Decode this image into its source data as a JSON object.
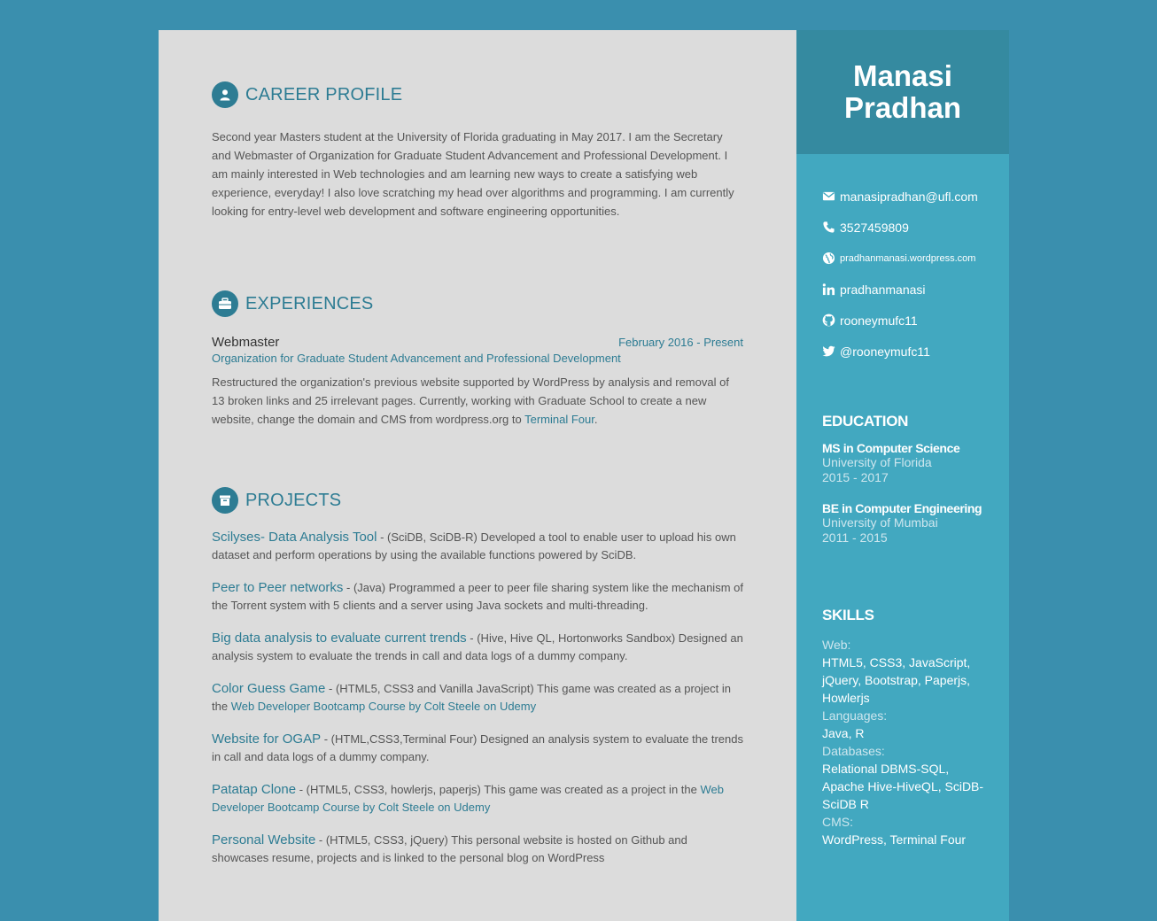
{
  "profile": {
    "first_name": "Manasi",
    "last_name": "Pradhan"
  },
  "contact": [
    {
      "icon": "envelope-icon",
      "text": "manasipradhan@ufl.com"
    },
    {
      "icon": "phone-icon",
      "text": "3527459809"
    },
    {
      "icon": "globe-icon",
      "text": "pradhanmanasi.wordpress.com"
    },
    {
      "icon": "linkedin-icon",
      "text": "pradhanmanasi"
    },
    {
      "icon": "github-icon",
      "text": "rooneymufc11"
    },
    {
      "icon": "twitter-icon",
      "text": "@rooneymufc11"
    }
  ],
  "education": {
    "title": "EDUCATION",
    "items": [
      {
        "degree": "MS in Computer Science",
        "school": "University of Florida",
        "years": "2015 - 2017"
      },
      {
        "degree": "BE in Computer Engineering",
        "school": "University of Mumbai",
        "years": "2011 - 2015"
      }
    ]
  },
  "skills": {
    "title": "SKILLS",
    "groups": [
      {
        "category": "Web:",
        "value": "HTML5, CSS3, JavaScript, jQuery, Bootstrap, Paperjs, Howlerjs"
      },
      {
        "category": "Languages:",
        "value": "Java, R"
      },
      {
        "category": "Databases:",
        "value": "Relational DBMS-SQL, Apache Hive-HiveQL, SciDB-SciDB R"
      },
      {
        "category": "CMS:",
        "value": "WordPress, Terminal Four"
      }
    ]
  },
  "career": {
    "title": "CAREER PROFILE",
    "text": "Second year Masters student at the University of Florida graduating in May 2017. I am the Secretary and Webmaster of Organization for Graduate Student Advancement and Professional Development. I am mainly interested in Web technologies and am learning new ways to create a satisfying web experience, everyday! I also love scratching my head over algorithms and programming. I am currently looking for entry-level web development and software engineering opportunities."
  },
  "experiences": {
    "title": "EXPERIENCES",
    "job": {
      "role": "Webmaster",
      "date": "February 2016 - Present",
      "org": "Organization for Graduate Student Advancement and Professional Development",
      "desc": "Restructured the organization's previous website supported by WordPress by analysis and removal of 13 broken links and 25 irrelevant pages. Currently, working with Graduate School to create a new website, change the domain and CMS from wordpress.org to ",
      "link": "Terminal Four",
      "end": "."
    }
  },
  "projects": {
    "title": "PROJECTS",
    "items": [
      {
        "name": "Scilyses- Data Analysis Tool",
        "desc": " - (SciDB, SciDB-R) Developed a tool to enable user to upload his own dataset and perform operations by using the available functions powered by SciDB.",
        "link": ""
      },
      {
        "name": "Peer to Peer networks",
        "desc": " - (Java) Programmed a peer to peer file sharing system like the mechanism of the Torrent system with 5 clients and a server using Java sockets and multi-threading.",
        "link": ""
      },
      {
        "name": "Big data analysis to evaluate current trends",
        "desc": " - (Hive, Hive QL, Hortonworks Sandbox) Designed an analysis system to evaluate the trends in call and data logs of a dummy company.",
        "link": ""
      },
      {
        "name": "Color Guess Game",
        "desc": " - (HTML5, CSS3 and Vanilla JavaScript) This game was created as a project in the ",
        "link": "Web Developer Bootcamp Course by Colt Steele on Udemy"
      },
      {
        "name": "Website for OGAP",
        "desc": " - (HTML,CSS3,Terminal Four) Designed an analysis system to evaluate the trends in call and data logs of a dummy company.",
        "link": ""
      },
      {
        "name": "Patatap Clone",
        "desc": " - (HTML5, CSS3, howlerjs, paperjs) This game was created as a project in the ",
        "link": "Web Developer Bootcamp Course by Colt Steele on Udemy"
      },
      {
        "name": "Personal Website",
        "desc": " - (HTML5, CSS3, jQuery) This personal website is hosted on Github and showcases resume, projects and is linked to the personal blog on WordPress",
        "link": ""
      }
    ]
  },
  "colors": {
    "background": "#3a8fae",
    "main_panel": "#dcdcdc",
    "sidebar": "#42a8c0",
    "sidebar_header": "#358aa0",
    "accent": "#2d7c93"
  }
}
